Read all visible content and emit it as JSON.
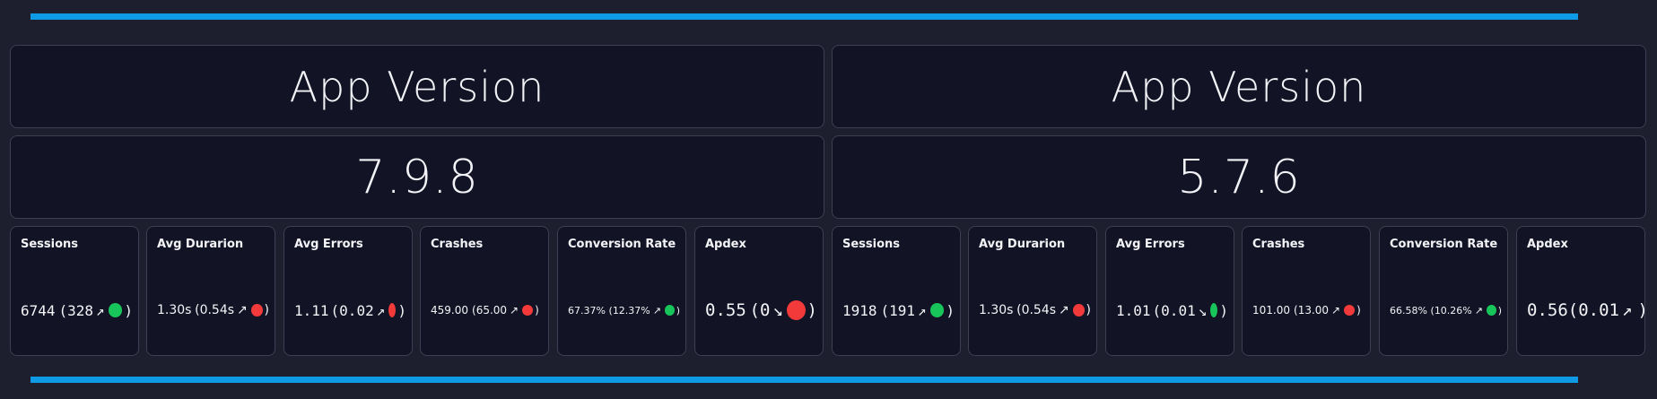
{
  "colors": {
    "background": "#1e1f2e",
    "card": "#121324",
    "accent_bar": "#0f9ae6",
    "good": "#17c55a",
    "bad": "#f23a3a"
  },
  "panels": [
    {
      "title": "App Version",
      "version": "7.9.8",
      "metrics": [
        {
          "label": "Sessions",
          "value": "6744",
          "delta": "328",
          "arrow": "↗",
          "status": "good"
        },
        {
          "label": "Avg Durarion",
          "value": "1.30s",
          "delta": "0.54s",
          "arrow": "↗",
          "status": "bad"
        },
        {
          "label": "Avg Errors",
          "value": "1.11",
          "delta": "0.02",
          "arrow": "↗",
          "status": "bad"
        },
        {
          "label": "Crashes",
          "value": "459.00",
          "delta": "65.00",
          "arrow": "↗",
          "status": "bad"
        },
        {
          "label": "Conversion Rate",
          "value": "67.37%",
          "delta": "12.37%",
          "arrow": "↗",
          "status": "good"
        },
        {
          "label": "Apdex",
          "value": "0.55",
          "delta": "0",
          "arrow": "↘",
          "status": "bad"
        }
      ]
    },
    {
      "title": "App Version",
      "version": "5.7.6",
      "metrics": [
        {
          "label": "Sessions",
          "value": "1918",
          "delta": "191",
          "arrow": "↗",
          "status": "good"
        },
        {
          "label": "Avg Durarion",
          "value": "1.30s",
          "delta": "0.54s",
          "arrow": "↗",
          "status": "bad"
        },
        {
          "label": "Avg Errors",
          "value": "1.01",
          "delta": "0.01",
          "arrow": "↘",
          "status": "good"
        },
        {
          "label": "Crashes",
          "value": "101.00",
          "delta": "13.00",
          "arrow": "↗",
          "status": "bad"
        },
        {
          "label": "Conversion Rate",
          "value": "66.58%",
          "delta": "10.26%",
          "arrow": "↗",
          "status": "good"
        },
        {
          "label": "Apdex",
          "value": "0.56",
          "delta": "0.01",
          "arrow": "↗",
          "status": "good"
        }
      ]
    }
  ]
}
